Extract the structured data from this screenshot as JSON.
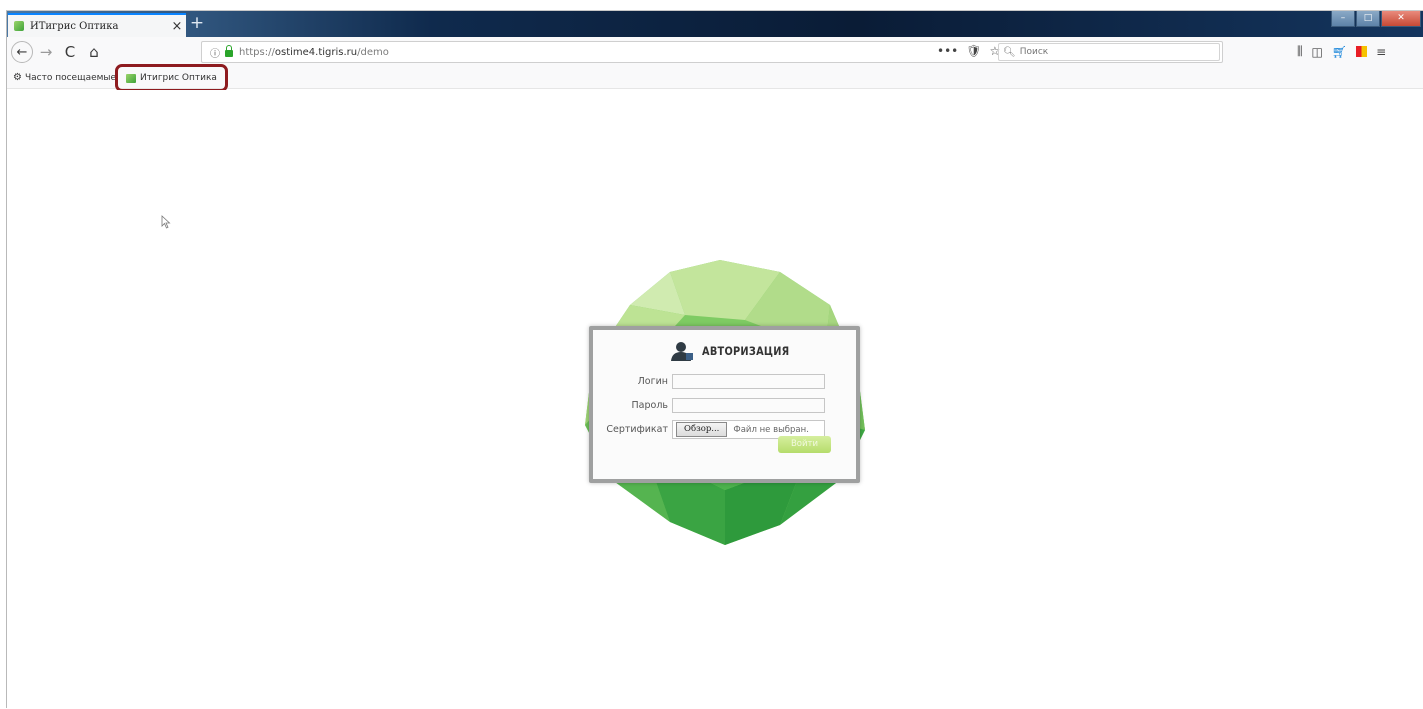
{
  "browser": {
    "tab": {
      "title": "ИТигрис Оптика",
      "close_glyph": "×"
    },
    "new_tab_glyph": "+",
    "window_controls": [
      "–",
      "□",
      "✕"
    ],
    "url": {
      "prefix": "https://",
      "host": "ostime4.tigris.ru",
      "path": "/demo"
    },
    "url_actions": [
      "•••",
      "🛡",
      "☆"
    ],
    "search": {
      "placeholder": "Поиск"
    },
    "nav_icons": {
      "back": "←",
      "forward": "→",
      "reload": "C",
      "home": "⌂"
    },
    "toolbar_icons": [
      "library-icon",
      "sidebar-icon",
      "cart-icon",
      "flag-icon",
      "menu-icon"
    ]
  },
  "bookmarks": [
    {
      "label": "Часто посещаемые",
      "icon": "gear-icon"
    },
    {
      "label": "Итигрис Оптика",
      "icon": "tigris-favicon",
      "highlighted": true
    }
  ],
  "login": {
    "title": "АВТОРИЗАЦИЯ",
    "login_label": "Логин",
    "password_label": "Пароль",
    "certificate_label": "Сертификат",
    "browse_label": "Обзор...",
    "file_status": "Файл не выбран.",
    "submit_label": "Войти"
  },
  "colors": {
    "highlight_border": "#8e1b1f",
    "gem_light": "#b8e08f",
    "gem_dark": "#2f9b3c",
    "submit_button": "#c4e68a"
  }
}
